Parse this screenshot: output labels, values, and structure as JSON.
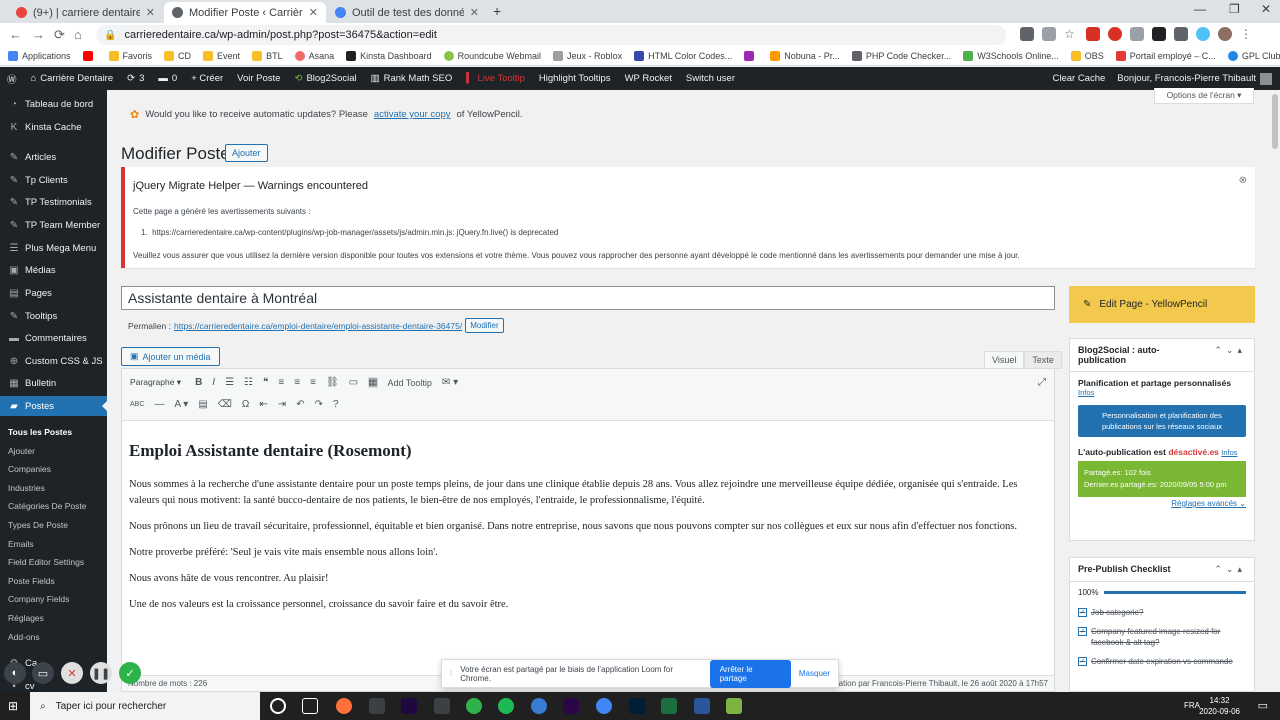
{
  "browser": {
    "tabs": [
      {
        "title": "(9+) | carriere dentaire",
        "active": false,
        "color": "#e8453c"
      },
      {
        "title": "Modifier Poste ‹ Carrière Dentaire",
        "active": true,
        "color": "#5f6368"
      },
      {
        "title": "Outil de test des données structu",
        "active": false,
        "color": "#4285f4"
      }
    ],
    "new_tab": "+",
    "url": "carrieredentaire.ca/wp-admin/post.php?post=36475&action=edit",
    "bookmarks": [
      "Applications",
      "",
      "Favoris",
      "CD",
      "Event",
      "BTL",
      "Asana",
      "Kinsta Dashboard",
      "Roundcube Webmail",
      "Jeux - Roblox",
      "HTML Color Codes...",
      "",
      "Nobuna - Pr...",
      "PHP Code Checker...",
      "W3Schools Online...",
      "OBS",
      "Portail employé – C...",
      "GPL Clubs"
    ]
  },
  "adminbar": {
    "site": "Carrière Dentaire",
    "updates": "3",
    "comments": "0",
    "new": "+ Créer",
    "view": "Voir Poste",
    "blog2social": "Blog2Social",
    "rankmath": "Rank Math SEO",
    "livetooltip": "Live Tooltip",
    "highlight": "Highlight Tooltips",
    "rocket": "WP Rocket",
    "switch": "Switch user",
    "clear": "Clear Cache",
    "greeting": "Bonjour, Francois-Pierre Thibault"
  },
  "sidebar": {
    "items": [
      {
        "label": "Tableau de bord",
        "icon": "dashboard-icon"
      },
      {
        "label": "Kinsta Cache",
        "icon": "kinsta-icon"
      },
      {
        "label": "Articles",
        "icon": "pin-icon"
      },
      {
        "label": "Tp Clients",
        "icon": "pin-icon"
      },
      {
        "label": "TP Testimonials",
        "icon": "pin-icon"
      },
      {
        "label": "TP Team Member",
        "icon": "pin-icon"
      },
      {
        "label": "Plus Mega Menu",
        "icon": "menu-icon"
      },
      {
        "label": "Médias",
        "icon": "media-icon"
      },
      {
        "label": "Pages",
        "icon": "pages-icon"
      },
      {
        "label": "Tooltips",
        "icon": "pin-icon"
      },
      {
        "label": "Commentaires",
        "icon": "comments-icon"
      },
      {
        "label": "Custom CSS & JS",
        "icon": "plus-icon"
      },
      {
        "label": "Bulletin",
        "icon": "bulletin-icon"
      },
      {
        "label": "Postes",
        "icon": "postes-icon"
      }
    ],
    "sub": [
      "Tous les Postes",
      "Ajouter",
      "Companies",
      "Industries",
      "Catégories De Poste",
      "Types De Poste",
      "Emails",
      "Field Editor Settings",
      "Poste Fields",
      "Company Fields",
      "Réglages",
      "Add-ons"
    ],
    "bottom": [
      "Ca...",
      "cv"
    ]
  },
  "screen_options": "Options de l'écran ▾",
  "yp_notice": {
    "before": "Would you like to receive automatic updates? Please",
    "link": "activate your copy",
    "after": "of YellowPencil."
  },
  "page_title": "Modifier Poste",
  "add_new": "Ajouter",
  "jq": {
    "heading": "jQuery Migrate Helper — Warnings encountered",
    "intro": "Cette page a généré les avertissements suivants :",
    "item": "https://carrieredentaire.ca/wp-content/plugins/wp-job-manager/assets/js/admin.min.js: jQuery.fn.live() is deprecated",
    "footer": "Veuillez vous assurer que vous utilisez la dernière version disponible pour toutes vos extensions et votre thème. Vous pouvez vous rapprocher des personne ayant développé le code mentionné dans les avertissements pour demander une mise à jour."
  },
  "post": {
    "title": "Assistante dentaire à Montréal",
    "permalink_label": "Permalien :",
    "permalink": "https://carrieredentaire.ca/emploi-dentaire/emploi-assistante-dentaire-36475/",
    "modify": "Modifier",
    "add_media": "Ajouter un média",
    "tab_visual": "Visuel",
    "tab_text": "Texte",
    "format": "Paragraphe",
    "add_tooltip": "Add Tooltip",
    "heading": "Emploi Assistante dentaire (Rosemont)",
    "paragraphs": [
      "Nous sommes à la recherche d'une assistante dentaire pour un poste temps pleins, de jour dans une clinique établie depuis 28 ans. Vous allez rejoindre une merveilleuse équipe dédiée, organisée qui s'entraide. Les valeurs qui nous motivent: la santé bucco-dentaire de nos patients, le bien-être de nos employés, l'entraide, le professionnalisme, l'équité.",
      "Nous prônons un lieu de travail sécuritaire, professionnel, équitable et bien organisé. Dans notre entreprise, nous savons que nous pouvons compter sur nos collègues et eux sur nous afin d'effectuer nos fonctions.",
      "Notre proverbe préféré: 'Seul je vais vite mais ensemble nous allons loin'.",
      "Nous avons hâte de vous rencontrer. Au plaisir!",
      "Une de nos valeurs est la croissance personnel, croissance du savoir faire et du savoir être."
    ],
    "wordcount": "Nombre de mots : 226",
    "lastmod": "Dernière modification par Francois-Pierre Thibault, le 26 août 2020 à 17h57"
  },
  "yellowpencil": "Edit Page - YellowPencil",
  "b2s": {
    "title": "Blog2Social : auto-publication",
    "section": "Planification et partage personnalisés",
    "info": "Infos",
    "button": "Personnalisation et planification des publications sur les réseaux sociaux",
    "status_label": "L'auto-publication est",
    "status_value": "désactivé.es",
    "status_info": "Infos",
    "shared": "Partagé.es: 102 fois",
    "last_shared": "Dernier.es partagé.es: 2020/09/05 5:00 pm",
    "advanced": "Réglages avancés"
  },
  "ppc": {
    "title": "Pre-Publish Checklist",
    "progress": "100%",
    "progress_value": 1.0,
    "items": [
      "Job categorie?",
      "Company featured image resized for facebook & alt tag?",
      "Confirmer date expiration vs commande"
    ]
  },
  "loom": {
    "message": "Votre écran est partagé par le biais de l'application Loom for Chrome.",
    "stop": "Arrêter le partage",
    "hide": "Masquer"
  },
  "taskbar": {
    "search": "Taper ici pour rechercher",
    "lang": "FRA",
    "time": "14:32",
    "date": "2020-09-06"
  }
}
